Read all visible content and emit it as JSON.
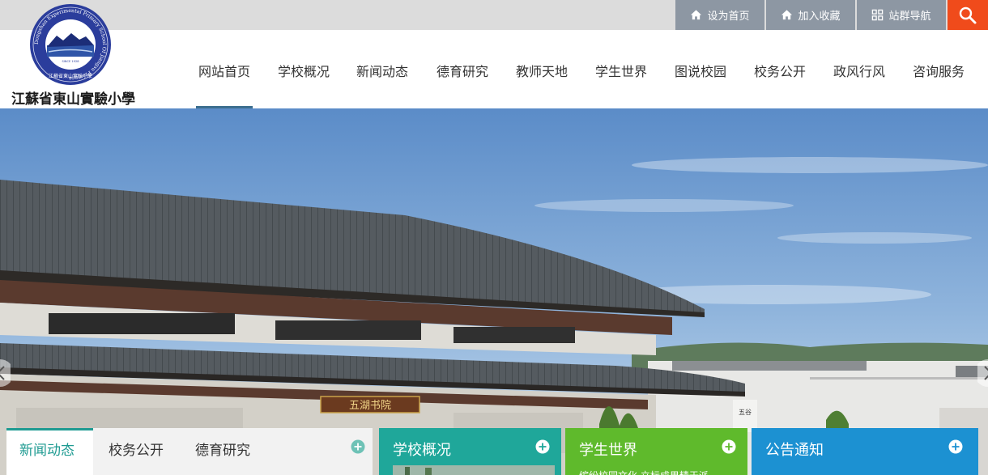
{
  "topbar": {
    "set_home": "设为首页",
    "add_favorite": "加入收藏",
    "site_group_nav": "站群导航"
  },
  "header": {
    "school_name": "江蘇省東山實驗小學",
    "logo_text_en": "Dongshan Experimental Primary School Of Jiangsu Province",
    "logo_since": "SINCE 1928",
    "logo_text_cn": "江蘇省東山實驗小學"
  },
  "nav": {
    "items": [
      {
        "label": "网站首页"
      },
      {
        "label": "学校概况"
      },
      {
        "label": "新闻动态"
      },
      {
        "label": "德育研究"
      },
      {
        "label": "教师天地"
      },
      {
        "label": "学生世界"
      },
      {
        "label": "图说校园"
      },
      {
        "label": "校务公开"
      },
      {
        "label": "政风行风"
      },
      {
        "label": "咨询服务"
      }
    ],
    "active_index": 0
  },
  "banner": {
    "plaque_text": "五湖书院",
    "sign_text": "五谷"
  },
  "panels": {
    "tabs": [
      {
        "label": "新闻动态"
      },
      {
        "label": "校务公开"
      },
      {
        "label": "德育研究"
      }
    ],
    "school_overview": "学校概况",
    "student_world": "学生世界",
    "student_world_snippet": "缤纷校园文化 立标成果精于派",
    "notices": "公告通知"
  },
  "colors": {
    "utility_bg": "#8d97a3",
    "search_bg": "#f04b1b",
    "accent_teal": "#1fa79a",
    "accent_green": "#5fba2c",
    "accent_blue": "#1c91d2",
    "nav_underline": "#3c6e8f"
  }
}
